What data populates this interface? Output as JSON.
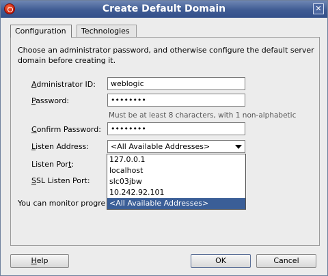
{
  "window": {
    "title": "Create Default Domain"
  },
  "tabs": [
    {
      "label": "Configuration",
      "active": true
    },
    {
      "label": "Technologies",
      "active": false
    }
  ],
  "intro_text": "Choose an administrator password, and otherwise configure the default server domain before creating it.",
  "form": {
    "admin_id": {
      "label": "Administrator ID:",
      "value": "weblogic"
    },
    "password": {
      "label": "Password:",
      "value": "••••••••"
    },
    "password_hint": "Must be at least 8 characters, with 1 non-alphabetic",
    "confirm_password": {
      "label": "Confirm Password:",
      "value": "••••••••"
    },
    "listen_address": {
      "label": "Listen Address:",
      "value": "<All Available Addresses>"
    },
    "listen_port": {
      "label": "Listen Port:"
    },
    "ssl_listen_port": {
      "label": "SSL Listen Port:"
    },
    "monitor_text": "You can monitor progre"
  },
  "dropdown": {
    "options": [
      "127.0.0.1",
      "localhost",
      "slc03jbw",
      "10.242.92.101",
      "<All Available Addresses>"
    ],
    "selected": "<All Available Addresses>"
  },
  "buttons": {
    "help": "Help",
    "ok": "OK",
    "cancel": "Cancel"
  },
  "colors": {
    "titlebar": "#3f5b93",
    "selection": "#3a5e97"
  }
}
